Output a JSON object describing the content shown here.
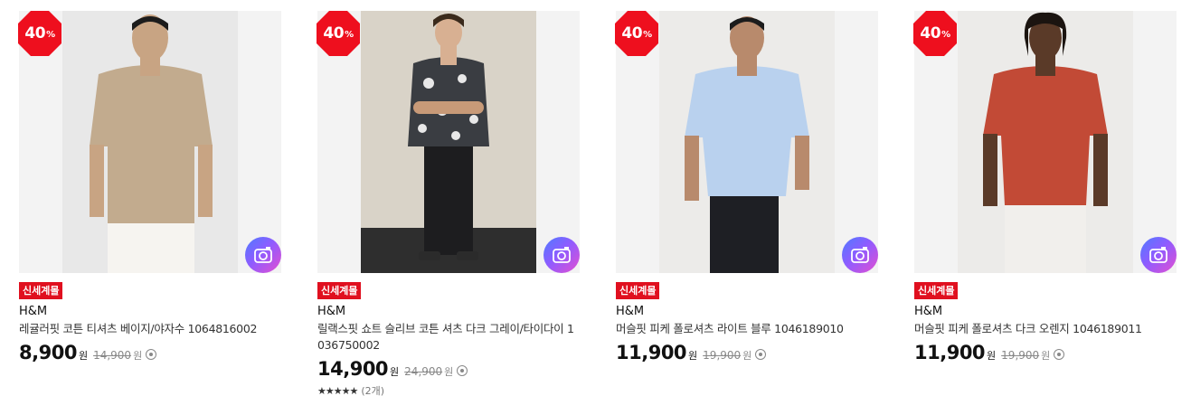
{
  "colors": {
    "discount_badge": "#ee0f1e",
    "tag_bg": "#e0101f",
    "accent_gradient": [
      "#4f7bff",
      "#8e5cff",
      "#e44fd1"
    ]
  },
  "products": [
    {
      "discount": "40",
      "discount_unit": "%",
      "tag": "신세계몰",
      "brand": "H&M",
      "name": "레귤러핏 코튼 티셔츠 베이지/야자수 1064816002",
      "price": "8,900",
      "currency": "원",
      "original_price": "14,900",
      "original_currency": "원",
      "shirt_color": "#c2ab8e",
      "pants_color": "#f4f2ee",
      "shoe_color": "#ffffff"
    },
    {
      "discount": "40",
      "discount_unit": "%",
      "tag": "신세계몰",
      "brand": "H&M",
      "name": "릴랙스핏 쇼트 슬리브 코튼 셔츠 다크 그레이/타이다이 1036750002",
      "price": "14,900",
      "currency": "원",
      "original_price": "24,900",
      "original_currency": "원",
      "rating_stars": "★★★★★",
      "rating_count": "(2개)",
      "shirt_color": "#3a3d42",
      "pants_color": "#1d1d1f",
      "shoe_color": "#2b2b2b"
    },
    {
      "discount": "40",
      "discount_unit": "%",
      "tag": "신세계몰",
      "brand": "H&M",
      "name": "머슬핏 피케 폴로셔츠 라이트 블루 1046189010",
      "price": "11,900",
      "currency": "원",
      "original_price": "19,900",
      "original_currency": "원",
      "shirt_color": "#b9d1ee",
      "pants_color": "#1e1f24",
      "shoe_color": "#1e1f24"
    },
    {
      "discount": "40",
      "discount_unit": "%",
      "tag": "신세계몰",
      "brand": "H&M",
      "name": "머슬핏 피케 폴로셔츠 다크 오렌지 1046189011",
      "price": "11,900",
      "currency": "원",
      "original_price": "19,900",
      "original_currency": "원",
      "shirt_color": "#c24a36",
      "pants_color": "#f1efec",
      "shoe_color": "#f1efec"
    }
  ]
}
